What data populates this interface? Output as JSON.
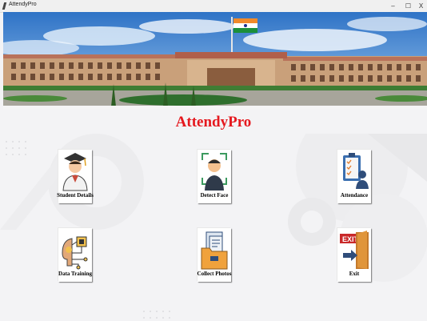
{
  "window": {
    "title": "AttendyPro",
    "minimize_glyph": "–",
    "maximize_glyph": "☐",
    "close_glyph": "X"
  },
  "header": {
    "app_title": "AttendyPro"
  },
  "tiles": [
    {
      "label": "Student Details",
      "icon": "student-icon"
    },
    {
      "label": "Detect Face",
      "icon": "face-scan-icon"
    },
    {
      "label": "Attendance",
      "icon": "attendance-clipboard-icon"
    },
    {
      "label": "Data Training",
      "icon": "ai-brain-icon"
    },
    {
      "label": "Collect Photos",
      "icon": "photo-folder-icon"
    },
    {
      "label": "Exit",
      "icon": "exit-door-icon"
    }
  ],
  "colors": {
    "title_red": "#e5191f",
    "sky": "#4a8fd4",
    "building": "#c9a07a"
  }
}
